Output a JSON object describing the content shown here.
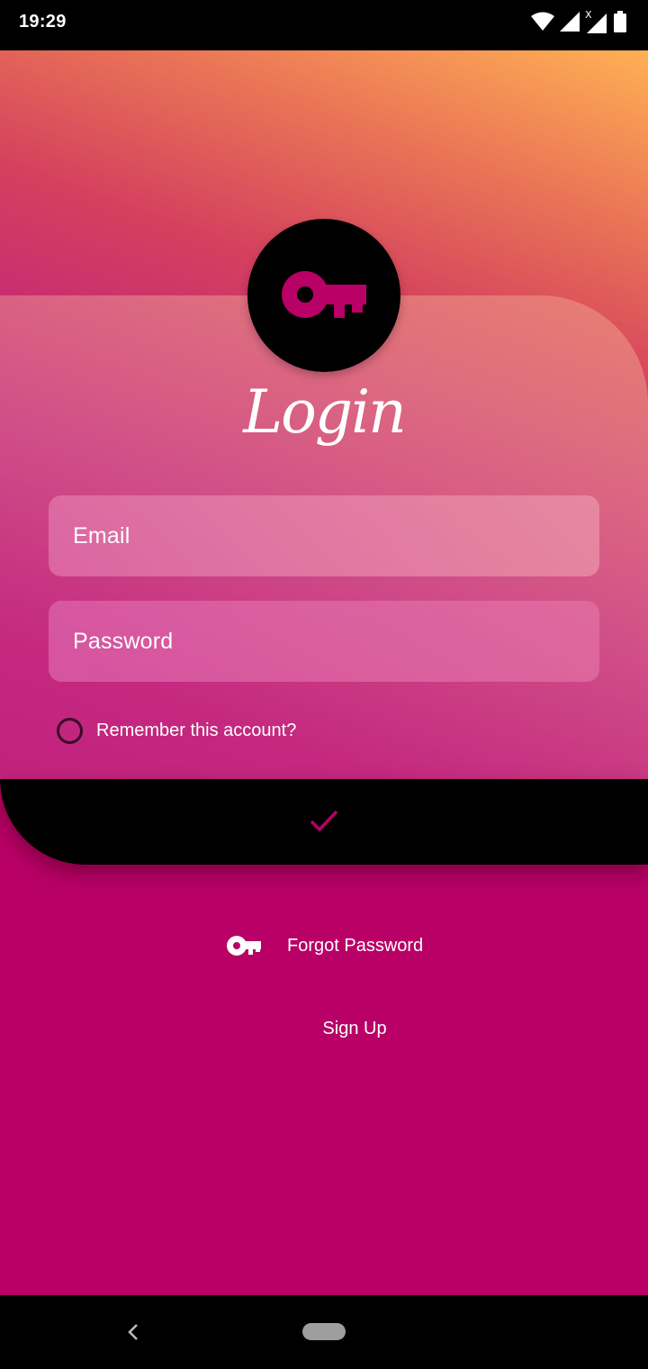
{
  "status_bar": {
    "time": "19:29",
    "icons": [
      "wifi-icon",
      "cell-signal-icon",
      "cell-signal-x-icon",
      "battery-icon"
    ]
  },
  "header": {
    "logo_icon": "key-icon",
    "title": "Login"
  },
  "form": {
    "email_placeholder": "Email",
    "password_placeholder": "Password",
    "remember_label": "Remember this account?",
    "remember_checked": false,
    "submit_icon": "check-icon"
  },
  "links": {
    "forgot_icon": "key-icon",
    "forgot_label": "Forgot Password",
    "signup_label": "Sign Up"
  },
  "colors": {
    "accent": "#b80066",
    "gradient_top": "#ffb054",
    "gradient_mid": "#d4405e",
    "submit_bar": "#000000"
  }
}
